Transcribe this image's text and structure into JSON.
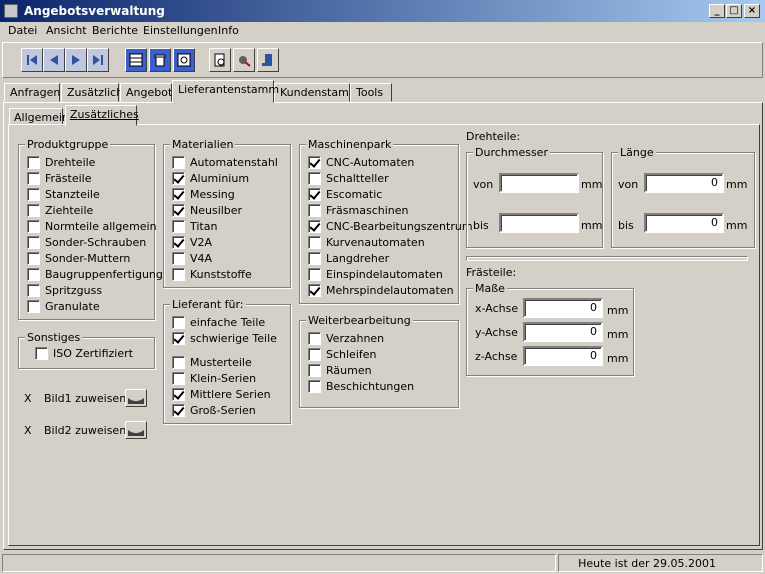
{
  "window": {
    "title": "Angebotsverwaltung",
    "min": "_",
    "max": "□",
    "close": "×"
  },
  "menu": [
    "Datei",
    "Ansicht",
    "Berichte",
    "Einstellungen",
    "Info"
  ],
  "tabs": [
    "Anfragen",
    "Zusätzlich",
    "Angebot",
    "Lieferantenstamm",
    "Kundenstamm",
    "Tools"
  ],
  "subtabs": [
    "Allgemein",
    "Zusätzliches"
  ],
  "produktgruppe": {
    "title": "Produktgruppe",
    "items": [
      {
        "label": "Drehteile",
        "checked": false
      },
      {
        "label": "Frästeile",
        "checked": false
      },
      {
        "label": "Stanzteile",
        "checked": false
      },
      {
        "label": "Ziehteile",
        "checked": false
      },
      {
        "label": "Normteile allgemein",
        "checked": false
      },
      {
        "label": "Sonder-Schrauben",
        "checked": false
      },
      {
        "label": "Sonder-Muttern",
        "checked": false
      },
      {
        "label": "Baugruppenfertigung",
        "checked": false
      },
      {
        "label": "Spritzguss",
        "checked": false
      },
      {
        "label": "Granulate",
        "checked": false
      }
    ]
  },
  "sonstiges": {
    "title": "Sonstiges",
    "items": [
      {
        "label": "ISO Zertifiziert",
        "checked": false
      }
    ]
  },
  "bilder": [
    {
      "x": "X",
      "label": "Bild1 zuweisen"
    },
    {
      "x": "X",
      "label": "Bild2 zuweisen"
    }
  ],
  "materialien": {
    "title": "Materialien",
    "items": [
      {
        "label": "Automatenstahl",
        "checked": false
      },
      {
        "label": "Aluminium",
        "checked": true
      },
      {
        "label": "Messing",
        "checked": true
      },
      {
        "label": "Neusilber",
        "checked": true
      },
      {
        "label": "Titan",
        "checked": false
      },
      {
        "label": "V2A",
        "checked": true
      },
      {
        "label": "V4A",
        "checked": false
      },
      {
        "label": "Kunststoffe",
        "checked": false
      }
    ]
  },
  "lieferant": {
    "title": "Lieferant für:",
    "items": [
      {
        "label": "einfache Teile",
        "checked": false
      },
      {
        "label": "schwierige Teile",
        "checked": true
      },
      {
        "label": "Musterteile",
        "checked": false
      },
      {
        "label": "Klein-Serien",
        "checked": false
      },
      {
        "label": "Mittlere Serien",
        "checked": true
      },
      {
        "label": "Groß-Serien",
        "checked": true
      }
    ]
  },
  "maschinenpark": {
    "title": "Maschinenpark",
    "items": [
      {
        "label": "CNC-Automaten",
        "checked": true
      },
      {
        "label": "Schaltteller",
        "checked": false
      },
      {
        "label": "Escomatic",
        "checked": true
      },
      {
        "label": "Fräsmaschinen",
        "checked": false
      },
      {
        "label": "CNC-Bearbeitungszentrum",
        "checked": true
      },
      {
        "label": "Kurvenautomaten",
        "checked": false
      },
      {
        "label": "Langdreher",
        "checked": false
      },
      {
        "label": "Einspindelautomaten",
        "checked": false
      },
      {
        "label": "Mehrspindelautomaten",
        "checked": true
      }
    ]
  },
  "weiterbearbeitung": {
    "title": "Weiterbearbeitung",
    "items": [
      {
        "label": "Verzahnen",
        "checked": false
      },
      {
        "label": "Schleifen",
        "checked": false
      },
      {
        "label": "Räumen",
        "checked": false
      },
      {
        "label": "Beschichtungen",
        "checked": false
      }
    ]
  },
  "drehteile": {
    "title": "Drehteile:",
    "durchmesser": {
      "title": "Durchmesser",
      "von_label": "von",
      "bis_label": "bis",
      "von": "",
      "bis": "",
      "unit": "mm"
    },
    "laenge": {
      "title": "Länge",
      "von_label": "von",
      "bis_label": "bis",
      "von": "0",
      "bis": "0",
      "unit": "mm"
    }
  },
  "fraesteile": {
    "title": "Frästeile:",
    "masse": {
      "title": "Maße",
      "unit": "mm",
      "rows": [
        {
          "label": "x-Achse",
          "value": "0"
        },
        {
          "label": "y-Achse",
          "value": "0"
        },
        {
          "label": "z-Achse",
          "value": "0"
        }
      ]
    }
  },
  "status": {
    "date_text": "Heute ist der 29.05.2001"
  }
}
